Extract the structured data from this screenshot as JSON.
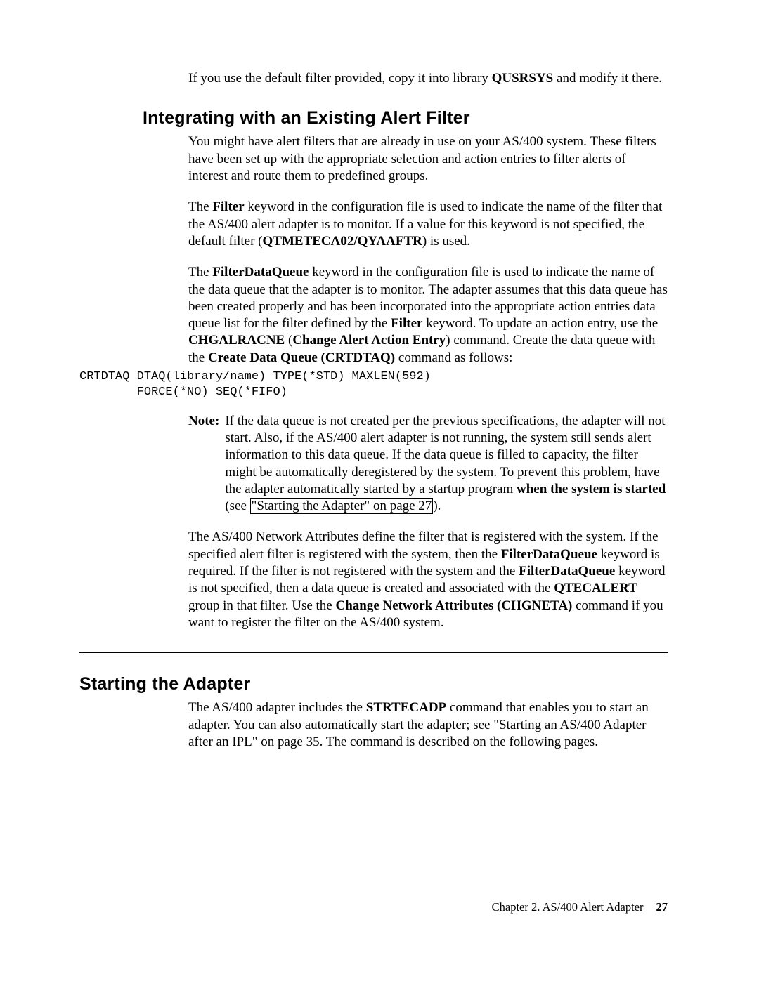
{
  "intro": {
    "p1a": "If you use the default filter provided, copy it into library ",
    "p1b": "QUSRSYS",
    "p1c": " and modify it there."
  },
  "section1": {
    "heading": "Integrating with an Existing Alert Filter",
    "p1": "You might have alert filters that are already in use on your AS/400 system. These filters have been set up with the appropriate selection and action entries to filter alerts of interest and route them to predefined groups.",
    "p2a": "The ",
    "p2b": "Filter",
    "p2c": " keyword in the configuration file is used to indicate the name of the filter that the AS/400 alert adapter is to monitor. If a value for this keyword is not specified, the default filter (",
    "p2d": "QTMETECA02/QYAAFTR",
    "p2e": ") is used.",
    "p3a": "The ",
    "p3b": "FilterDataQueue",
    "p3c": " keyword in the configuration file is used to indicate the name of the data queue that the adapter is to monitor. The adapter assumes that this data queue has been created properly and has been incorporated into the appropriate action entries data queue list for the filter defined by the ",
    "p3d": "Filter",
    "p3e": " keyword. To update an action entry, use the ",
    "p3f": "CHGALRACNE",
    "p3g": " (",
    "p3h": "Change Alert Action Entry",
    "p3i": ") command. Create the data queue with the ",
    "p3j": "Create Data Queue (CRTDTAQ)",
    "p3k": " command as follows:",
    "code": "CRTDTAQ DTAQ(library/name) TYPE(*STD) MAXLEN(592)\n        FORCE(*NO) SEQ(*FIFO)",
    "noteLabel": "Note:",
    "note_a": "If the data queue is not created per the previous specifications, the adapter will not start. Also, if the AS/400 alert adapter is not running, the system still sends alert information to this data queue. If the data queue is filled to capacity, the filter might be automatically deregistered by the system. To prevent this problem, have the adapter automatically started by a startup program ",
    "note_b": "when the system is started",
    "note_c": " (see ",
    "note_link": "\"Starting the Adapter\" on page 27",
    "note_d": ").",
    "p5a": "The AS/400 Network Attributes define the filter that is registered with the system. If the specified alert filter is registered with the system, then the ",
    "p5b": "FilterDataQueue",
    "p5c": " keyword is required. If the filter is not registered with the system and the ",
    "p5d": "FilterDataQueue",
    "p5e": " keyword is not specified, then a data queue is created and associated with the ",
    "p5f": "QTECALERT",
    "p5g": " group in that filter. Use the ",
    "p5h": "Change Network Attributes (CHGNETA)",
    "p5i": " command if you want to register the filter on the AS/400 system."
  },
  "section2": {
    "heading": "Starting the Adapter",
    "p1a": "The AS/400 adapter includes the ",
    "p1b": "STRTECADP",
    "p1c": " command that enables you to start an adapter. You can also automatically start the adapter; see \"Starting an AS/400 Adapter after an IPL\" on page 35. The command is described on the following pages."
  },
  "footer": {
    "chapter": "Chapter 2. AS/400 Alert Adapter",
    "page": "27"
  }
}
